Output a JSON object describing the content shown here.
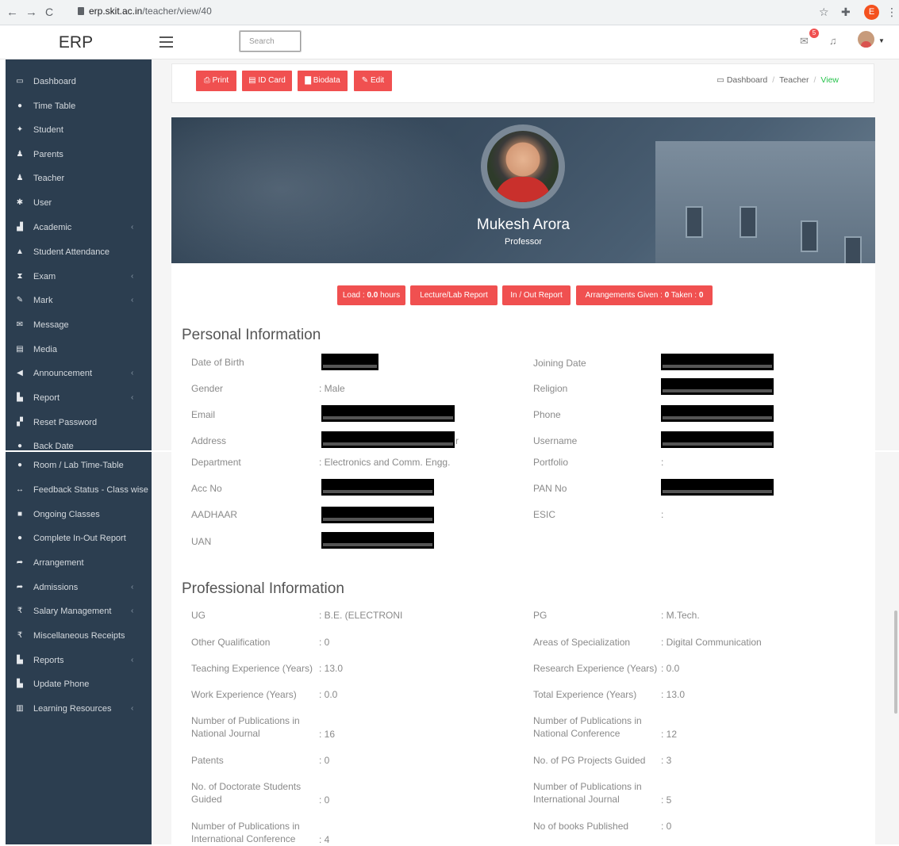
{
  "browser": {
    "url_host": "erp.skit.ac.in",
    "url_path": "/teacher/view/40",
    "profile_initial": "E"
  },
  "topbar": {
    "brand": "ERP",
    "search_placeholder": "Search",
    "mail_badge": "5"
  },
  "sidebar": {
    "items": [
      {
        "icon": "▭",
        "label": "Dashboard",
        "arrow": false
      },
      {
        "icon": "●",
        "label": "Time Table",
        "arrow": false
      },
      {
        "icon": "✦",
        "label": "Student",
        "arrow": false
      },
      {
        "icon": "♟",
        "label": "Parents",
        "arrow": false
      },
      {
        "icon": "♟",
        "label": "Teacher",
        "arrow": false
      },
      {
        "icon": "✱",
        "label": "User",
        "arrow": false
      },
      {
        "icon": "▟",
        "label": "Academic",
        "arrow": true
      },
      {
        "icon": "▲",
        "label": "Student Attendance",
        "arrow": false
      },
      {
        "icon": "⧗",
        "label": "Exam",
        "arrow": true
      },
      {
        "icon": "✎",
        "label": "Mark",
        "arrow": true
      },
      {
        "icon": "✉",
        "label": "Message",
        "arrow": false
      },
      {
        "icon": "▤",
        "label": "Media",
        "arrow": false
      },
      {
        "icon": "◀",
        "label": "Announcement",
        "arrow": true
      },
      {
        "icon": "▙",
        "label": "Report",
        "arrow": true
      },
      {
        "icon": "▞",
        "label": "Reset Password",
        "arrow": false
      },
      {
        "icon": "●",
        "label": "Back Date",
        "arrow": false
      },
      {
        "icon": "●",
        "label": "Room / Lab Time-Table",
        "arrow": false
      },
      {
        "icon": "↔",
        "label": "Feedback Status - Class wise",
        "arrow": false
      },
      {
        "icon": "■",
        "label": "Ongoing Classes",
        "arrow": false
      },
      {
        "icon": "●",
        "label": "Complete In-Out Report",
        "arrow": false
      },
      {
        "icon": "➦",
        "label": "Arrangement",
        "arrow": false
      },
      {
        "icon": "➦",
        "label": "Admissions",
        "arrow": true
      },
      {
        "icon": "₹",
        "label": "Salary Management",
        "arrow": true
      },
      {
        "icon": "₹",
        "label": "Miscellaneous Receipts",
        "arrow": false
      },
      {
        "icon": "▙",
        "label": "Reports",
        "arrow": true
      },
      {
        "icon": "▙",
        "label": "Update Phone",
        "arrow": false
      },
      {
        "icon": "▥",
        "label": "Learning Resources",
        "arrow": true
      }
    ]
  },
  "actions": {
    "print": "Print",
    "id_card": "ID Card",
    "biodata": "Biodata",
    "edit": "Edit"
  },
  "breadcrumb": {
    "dashboard": "Dashboard",
    "sep": "/",
    "teacher": "Teacher",
    "view": "View"
  },
  "profile": {
    "name": "Mukesh Arora",
    "role": "Professor"
  },
  "report_buttons": {
    "load_label": "Load : ",
    "load_value": "0.0",
    "load_unit": " hours",
    "lecture": "Lecture/Lab Report",
    "inout": "In / Out Report",
    "arr_label": "Arrangements Given : ",
    "arr_given": "0",
    "arr_taken_label": " Taken : ",
    "arr_taken": "0"
  },
  "personal": {
    "title": "Personal Information",
    "dob_label": "Date of Birth",
    "joining_label": "Joining Date",
    "gender_label": "Gender",
    "gender_value": ": Male",
    "religion_label": "Religion",
    "email_label": "Email",
    "phone_label": "Phone",
    "address_label": "Address",
    "address_tail": "r",
    "username_label": "Username",
    "dept_label": "Department",
    "dept_value": ": Electronics and Comm. Engg.",
    "portfolio_label": "Portfolio",
    "portfolio_value": ":",
    "acc_label": "Acc No",
    "pan_label": "PAN No",
    "aadhaar_label": "AADHAAR",
    "esic_label": "ESIC",
    "esic_value": ":",
    "uan_label": "UAN"
  },
  "professional": {
    "title": "Professional Information",
    "ug_label": "UG",
    "ug_value": ": B.E. (ELECTRONI",
    "pg_label": "PG",
    "pg_value": ": M.Tech.",
    "other_label": "Other Qualification",
    "other_value": ": 0",
    "spec_label": "Areas of Specialization",
    "spec_value": ": Digital Communication",
    "teach_label": "Teaching Experience (Years)",
    "teach_value": ": 13.0",
    "research_label": "Research Experience (Years)",
    "research_value": ": 0.0",
    "work_label": "Work Experience (Years)",
    "work_value": ": 0.0",
    "total_label": "Total Experience (Years)",
    "total_value": ": 13.0",
    "nat_j_label1": "Number of Publications in",
    "nat_j_label2": "National Journal",
    "nat_j_value": ": 16",
    "nat_c_label1": "Number of Publications in",
    "nat_c_label2": "National Conference",
    "nat_c_value": ": 12",
    "patents_label": "Patents",
    "patents_value": ": 0",
    "pgproj_label": "No. of PG Projects Guided",
    "pgproj_value": ": 3",
    "doc_label1": "No. of Doctorate Students",
    "doc_label2": "Guided",
    "doc_value": ": 0",
    "int_j_label1": "Number of Publications in",
    "int_j_label2": "International Journal",
    "int_j_value": ": 5",
    "int_c_label1": "Number of Publications in",
    "int_c_label2": "International Conference",
    "int_c_value": ": 4",
    "books_label": "No of books Published",
    "books_value": ": 0"
  }
}
